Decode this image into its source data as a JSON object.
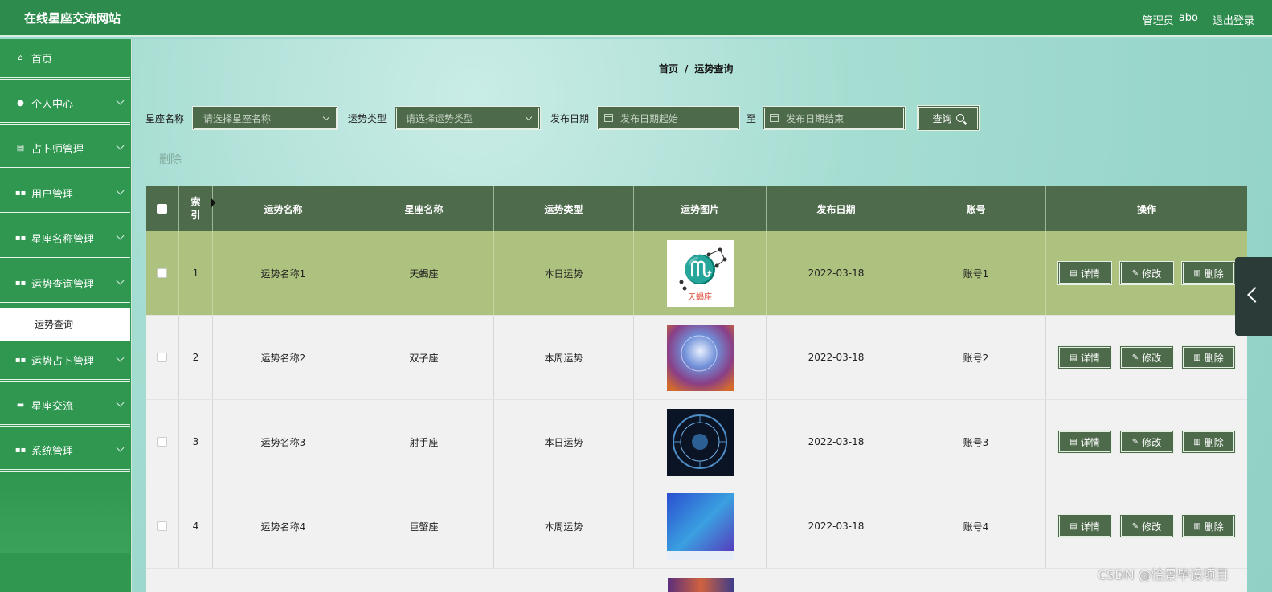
{
  "header": {
    "site_title": "在线星座交流网站",
    "user_role": "管理员",
    "username": "abo",
    "logout": "退出登录"
  },
  "sidebar": {
    "items": [
      {
        "label": "首页",
        "icon": "home-icon"
      },
      {
        "label": "个人中心",
        "icon": "user-icon"
      },
      {
        "label": "占卜师管理",
        "icon": "clipboard-icon"
      },
      {
        "label": "用户管理",
        "icon": "grid-icon"
      },
      {
        "label": "星座名称管理",
        "icon": "grid-icon"
      },
      {
        "label": "运势查询管理",
        "icon": "grid-icon"
      },
      {
        "label": "运势占卜管理",
        "icon": "grid-icon"
      },
      {
        "label": "星座交流",
        "icon": "chat-icon"
      },
      {
        "label": "系统管理",
        "icon": "grid-icon"
      }
    ],
    "sub_item": "运势查询"
  },
  "breadcrumb": {
    "home": "首页",
    "sep": "/",
    "current": "运势查询"
  },
  "search": {
    "zodiac_label": "星座名称",
    "zodiac_placeholder": "请选择星座名称",
    "type_label": "运势类型",
    "type_placeholder": "请选择运势类型",
    "date_label": "发布日期",
    "date_start_placeholder": "发布日期起始",
    "to": "至",
    "date_end_placeholder": "发布日期结束",
    "query_button": "查询"
  },
  "actions": {
    "delete": "删除"
  },
  "table": {
    "headers": {
      "index_1": "索",
      "index_2": "引",
      "name": "运势名称",
      "zodiac": "星座名称",
      "type": "运势类型",
      "image": "运势图片",
      "date": "发布日期",
      "account": "账号",
      "ops": "操作"
    },
    "rows": [
      {
        "index": "1",
        "name": "运势名称1",
        "zodiac": "天蝎座",
        "type": "本日运势",
        "date": "2022-03-18",
        "account": "账号1",
        "image_label": "天蝎座"
      },
      {
        "index": "2",
        "name": "运势名称2",
        "zodiac": "双子座",
        "type": "本周运势",
        "date": "2022-03-18",
        "account": "账号2"
      },
      {
        "index": "3",
        "name": "运势名称3",
        "zodiac": "射手座",
        "type": "本日运势",
        "date": "2022-03-18",
        "account": "账号3"
      },
      {
        "index": "4",
        "name": "运势名称4",
        "zodiac": "巨蟹座",
        "type": "本周运势",
        "date": "2022-03-18",
        "account": "账号4"
      }
    ],
    "op_labels": {
      "detail": "详情",
      "edit": "修改",
      "delete": "删除"
    }
  },
  "watermark": "CSDN @恰景毕设项目"
}
